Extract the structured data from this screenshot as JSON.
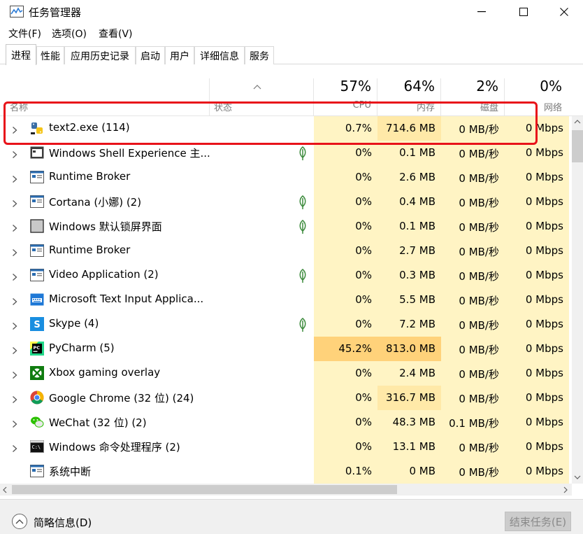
{
  "window": {
    "title": "任务管理器",
    "controls": [
      "minimize",
      "maximize",
      "close"
    ]
  },
  "menu": [
    "文件(F)",
    "选项(O)",
    "查看(V)"
  ],
  "tabs": [
    {
      "label": "进程",
      "active": true
    },
    {
      "label": "性能",
      "active": false
    },
    {
      "label": "应用历史记录",
      "active": false
    },
    {
      "label": "启动",
      "active": false
    },
    {
      "label": "用户",
      "active": false
    },
    {
      "label": "详细信息",
      "active": false
    },
    {
      "label": "服务",
      "active": false
    }
  ],
  "header": {
    "name_label": "名称",
    "status_label": "状态",
    "cpu_pct": "57%",
    "cpu_label": "CPU",
    "mem_pct": "64%",
    "mem_label": "内存",
    "disk_pct": "2%",
    "disk_label": "磁盘",
    "net_pct": "0%",
    "net_label": "网络"
  },
  "processes": [
    {
      "name": "text2.exe (114)",
      "icon": "python-exe-icon",
      "leaf": false,
      "expand": true,
      "cpu": "0.7%",
      "mem": "714.6 MB",
      "disk": "0 MB/秒",
      "net": "0 Mbps"
    },
    {
      "name": "Windows Shell Experience 主...",
      "icon": "app-window-dark-icon",
      "leaf": true,
      "expand": true,
      "cpu": "0%",
      "mem": "0.1 MB",
      "disk": "0 MB/秒",
      "net": "0 Mbps"
    },
    {
      "name": "Runtime Broker",
      "icon": "app-window-icon",
      "leaf": false,
      "expand": true,
      "cpu": "0%",
      "mem": "2.6 MB",
      "disk": "0 MB/秒",
      "net": "0 Mbps"
    },
    {
      "name": "Cortana (小娜) (2)",
      "icon": "app-window-icon",
      "leaf": true,
      "expand": true,
      "cpu": "0%",
      "mem": "0.4 MB",
      "disk": "0 MB/秒",
      "net": "0 Mbps"
    },
    {
      "name": "Windows 默认锁屏界面",
      "icon": "lockscreen-icon",
      "leaf": true,
      "expand": true,
      "cpu": "0%",
      "mem": "0.1 MB",
      "disk": "0 MB/秒",
      "net": "0 Mbps"
    },
    {
      "name": "Runtime Broker",
      "icon": "app-window-icon",
      "leaf": false,
      "expand": true,
      "cpu": "0%",
      "mem": "2.7 MB",
      "disk": "0 MB/秒",
      "net": "0 Mbps"
    },
    {
      "name": "Video Application (2)",
      "icon": "app-window-icon",
      "leaf": true,
      "expand": true,
      "cpu": "0%",
      "mem": "0.3 MB",
      "disk": "0 MB/秒",
      "net": "0 Mbps"
    },
    {
      "name": "Microsoft Text Input Applica...",
      "icon": "keyboard-icon",
      "leaf": false,
      "expand": true,
      "cpu": "0%",
      "mem": "5.5 MB",
      "disk": "0 MB/秒",
      "net": "0 Mbps"
    },
    {
      "name": "Skype (4)",
      "icon": "skype-icon",
      "leaf": true,
      "expand": true,
      "cpu": "0%",
      "mem": "7.2 MB",
      "disk": "0 MB/秒",
      "net": "0 Mbps"
    },
    {
      "name": "PyCharm (5)",
      "icon": "pycharm-icon",
      "leaf": false,
      "expand": true,
      "cpu": "45.2%",
      "mem": "813.0 MB",
      "disk": "0 MB/秒",
      "net": "0 Mbps",
      "hot": true
    },
    {
      "name": "Xbox gaming overlay",
      "icon": "xbox-icon",
      "leaf": false,
      "expand": true,
      "cpu": "0%",
      "mem": "2.4 MB",
      "disk": "0 MB/秒",
      "net": "0 Mbps"
    },
    {
      "name": "Google Chrome (32 位) (24)",
      "icon": "chrome-icon",
      "leaf": false,
      "expand": true,
      "cpu": "0%",
      "mem": "316.7 MB",
      "disk": "0 MB/秒",
      "net": "0 Mbps"
    },
    {
      "name": "WeChat (32 位) (2)",
      "icon": "wechat-icon",
      "leaf": false,
      "expand": true,
      "cpu": "0%",
      "mem": "48.3 MB",
      "disk": "0.1 MB/秒",
      "net": "0 Mbps"
    },
    {
      "name": "Windows 命令处理程序 (2)",
      "icon": "cmd-icon",
      "leaf": false,
      "expand": true,
      "cpu": "0%",
      "mem": "13.1 MB",
      "disk": "0 MB/秒",
      "net": "0 Mbps"
    },
    {
      "name": "系统中断",
      "icon": "app-window-icon",
      "leaf": false,
      "expand": false,
      "cpu": "0.1%",
      "mem": "0 MB",
      "disk": "0 MB/秒",
      "net": "0 Mbps"
    }
  ],
  "footer": {
    "fewer_details": "简略信息(D)",
    "end_task": "结束任务(E)"
  },
  "colors": {
    "cell_light": "#fff4c4",
    "cell_mem_med": "#ffe9a8",
    "cell_hot": "#ffd27a",
    "highlight_red": "#e8121a"
  }
}
